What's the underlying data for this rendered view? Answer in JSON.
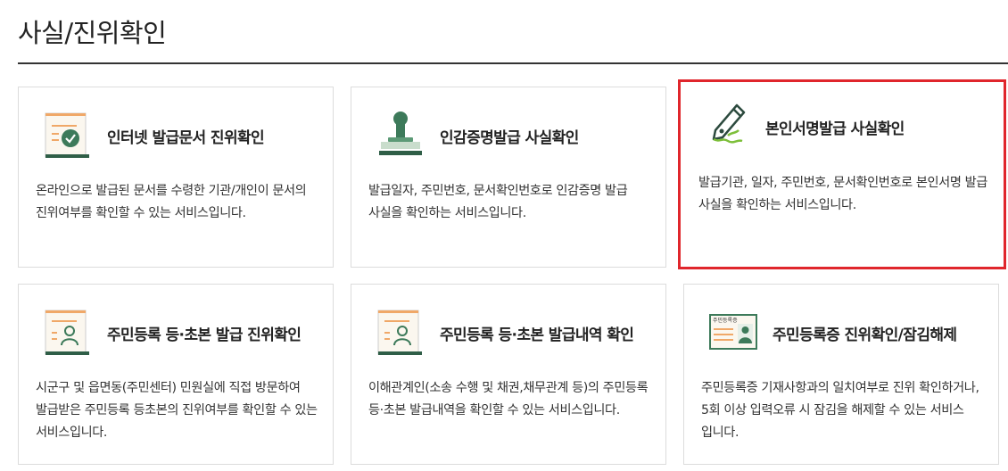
{
  "page": {
    "title": "사실/진위확인"
  },
  "cards": [
    {
      "title": "인터넷 발급문서 진위확인",
      "description": "온라인으로 발급된 문서를 수령한 기관/개인이 문서의 진위여부를 확인할 수 있는 서비스입니다.",
      "icon": "document-check-icon"
    },
    {
      "title": "인감증명발급 사실확인",
      "description": "발급일자, 주민번호, 문서확인번호로 인감증명 발급 사실을 확인하는 서비스입니다.",
      "icon": "seal-stamp-icon"
    },
    {
      "title": "본인서명발급 사실확인",
      "description": "발급기관, 일자, 주민번호, 문서확인번호로 본인서명 발급 사실을 확인하는 서비스입니다.",
      "icon": "fountain-pen-icon"
    },
    {
      "title": "주민등록 등·초본 발급 진위확인",
      "description": "시군구 및 읍면동(주민센터) 민원실에 직접 방문하여 발급받은 주민등록 등초본의 진위여부를 확인할 수 있는 서비스입니다.",
      "icon": "person-document-icon"
    },
    {
      "title": "주민등록 등·초본 발급내역 확인",
      "description": "이해관계인(소송 수행 및 채권,채무관계 등)의 주민등록 등·초본 발급내역을 확인할 수 있는 서비스입니다.",
      "icon": "person-document-icon"
    },
    {
      "title": "주민등록증 진위확인/잠김해제",
      "description": "주민등록증 기재사항과의 일치여부로 진위 확인하거나, 5회 이상 입력오류 시 잠김을 해제할 수 있는 서비스 입니다.",
      "icon": "id-card-icon",
      "icon_text": "주민등록증"
    }
  ],
  "colors": {
    "highlight": "#e0262c",
    "accent_orange": "#f0a868",
    "accent_green": "#3d7a5a"
  }
}
